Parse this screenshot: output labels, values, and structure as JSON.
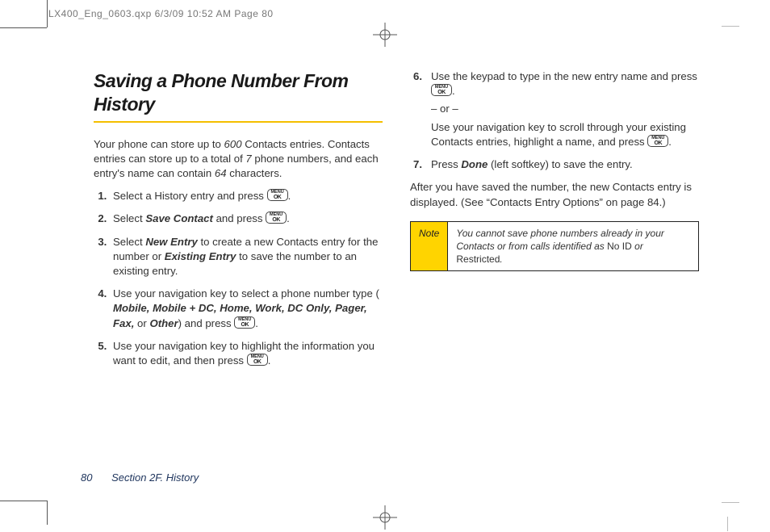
{
  "meta": {
    "slug": "LX400_Eng_0603.qxp  6/3/09  10:52 AM  Page 80"
  },
  "heading": "Saving a Phone Number From History",
  "intro": {
    "p1a": "Your phone can store up to ",
    "n1": "600",
    "p1b": " Contacts entries. Contacts entries can store up to a total of ",
    "n2": "7",
    "p1c": " phone numbers, and each entry's name can contain ",
    "n3": "64",
    "p1d": " characters."
  },
  "key": {
    "top": "MENU",
    "bottom": "OK"
  },
  "punct": {
    "period": "."
  },
  "steps": [
    {
      "a": "Select a History entry and press "
    },
    {
      "a": "Select ",
      "cmd": "Save Contact",
      "b": " and press "
    },
    {
      "a": "Select ",
      "cmd1": "New Entry",
      "b": " to create a new Contacts entry for the number or ",
      "cmd2": "Existing Entry",
      "c": " to save the number to an existing entry."
    },
    {
      "a": "Use your navigation key to select a phone number type (",
      "types": "Mobile, Mobile + DC, Home, Work, DC Only, Pager, Fax,",
      "b": " or ",
      "last": "Other",
      "c": ") and press "
    },
    {
      "a": "Use your navigation key to highlight the information you want to edit, and then press "
    },
    {
      "num": "6.",
      "a": "Use the keypad to type in the new entry name and press ",
      "or": "– or –",
      "b": "Use your navigation key to scroll through your existing Contacts entries, highlight a name, and press "
    },
    {
      "num": "7.",
      "a": "Press ",
      "cmd": "Done",
      "b": " (left softkey) to save the entry."
    }
  ],
  "closing": "After you have saved the number, the new Contacts entry is displayed. (See “Contacts Entry Options” on page 84.)",
  "note": {
    "label": "Note",
    "body1": "You cannot save phone numbers already in your Contacts or from calls identified as ",
    "k1": "No ID",
    "body2": " or ",
    "k2": "Restricted",
    "body3": "."
  },
  "footer": {
    "page": "80",
    "section": "Section 2F. History"
  }
}
